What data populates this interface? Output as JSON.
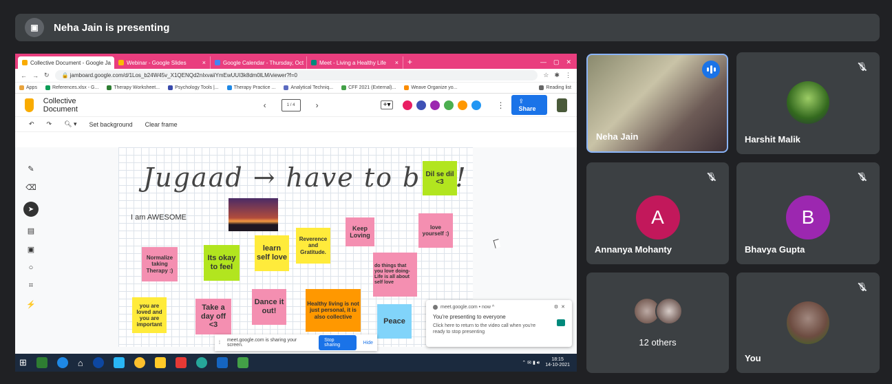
{
  "presenting_banner": {
    "icon": "presenter-avatar-icon",
    "text": "Neha Jain is presenting"
  },
  "browser": {
    "tabs": [
      {
        "label": "Collective Document - Google Ja",
        "fav_color": "#f9ab00",
        "active": true
      },
      {
        "label": "Webinar - Google Slides",
        "fav_color": "#fbbc04",
        "active": false
      },
      {
        "label": "Google Calendar - Thursday, Oct",
        "fav_color": "#4285f4",
        "active": false
      },
      {
        "label": "Meet - Living a Healthy Life",
        "fav_color": "#00897b",
        "active": false
      }
    ],
    "url": "jamboard.google.com/d/1Los_b24W45v_X1QENQd2nIxvaiiYmEwUUI3k8dm0lLM/viewer?f=0",
    "bookmarks": [
      "Apps",
      "References.xlsx - G...",
      "Therapy Worksheet...",
      "Psychology Tools |...",
      "Therapy Practice ...",
      "Analytical Techniq...",
      "CFF 2021 (External)...",
      "Weave Organize yo...",
      "Reading list"
    ]
  },
  "jamboard": {
    "doc_title": "Collective Document",
    "frame_indicator": "1 / 4",
    "share_label": "Share",
    "toolbar": {
      "set_background": "Set background",
      "clear_frame": "Clear frame"
    },
    "collab_colors": [
      "#e91e63",
      "#3f51b5",
      "#9c27b0",
      "#4caf50",
      "#ff9800",
      "#2196f3"
    ],
    "handwriting": "Jugaad → have to buy!",
    "text_box": "I am AWESOME",
    "notes": {
      "dil_se": "Dil se dil <3",
      "keep_loving": "Keep Loving",
      "love_yourself": "love yourself :)",
      "reverence": "Reverence and Gratitude.",
      "learn_self_love": "learn self love",
      "its_okay": "Its okay to feel",
      "normalize": "Normalize taking Therapy :)",
      "do_things": "do things that you love doing- Life is all about self love",
      "you_are_loved": "you are loved and you are important",
      "take_a_day": "Take a day off <3",
      "dance": "Dance it out!",
      "healthy_living": "Healthy living is not just personal, it is also collective",
      "peace": "Peace"
    }
  },
  "share_notice": {
    "text": "meet.google.com is sharing your screen.",
    "stop_label": "Stop sharing",
    "hide_label": "Hide"
  },
  "popup": {
    "source": "meet.google.com • now ^",
    "line1": "You're presenting to everyone",
    "line2": "Click here to return to the video call when you're ready to stop presenting"
  },
  "taskbar": {
    "time": "18:15",
    "date": "14-10-2021"
  },
  "participants": [
    {
      "name": "Neha Jain",
      "state": "speaking"
    },
    {
      "name": "Harshit Malik",
      "state": "muted"
    },
    {
      "name": "Annanya Mohanty",
      "initial": "A",
      "color": "#c2185b",
      "state": "muted"
    },
    {
      "name": "Bhavya Gupta",
      "initial": "B",
      "color": "#9c27b0",
      "state": "muted"
    },
    {
      "name": "12 others",
      "state": "group"
    },
    {
      "name": "You",
      "state": "muted"
    }
  ]
}
